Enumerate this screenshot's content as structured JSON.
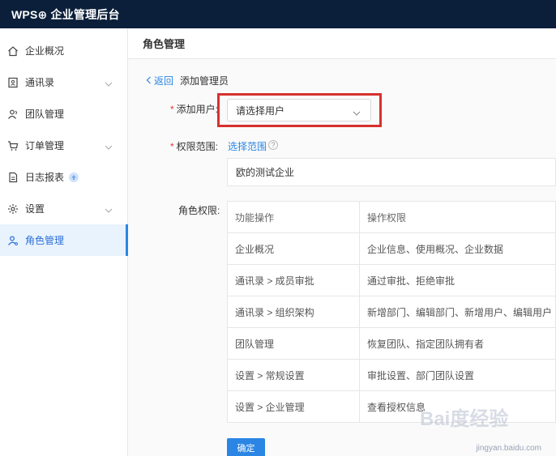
{
  "app": {
    "title": "WPS⊕ 企业管理后台"
  },
  "sidebar": {
    "items": [
      {
        "label": "企业概况"
      },
      {
        "label": "通讯录"
      },
      {
        "label": "团队管理"
      },
      {
        "label": "订单管理"
      },
      {
        "label": "日志报表"
      },
      {
        "label": "设置"
      },
      {
        "label": "角色管理"
      }
    ]
  },
  "page": {
    "title": "角色管理",
    "back_label": "返回",
    "crumb_current": "添加管理员"
  },
  "form": {
    "add_user_label": "添加用户:",
    "add_user_placeholder": "请选择用户",
    "scope_label": "权限范围:",
    "scope_link": "选择范围",
    "scope_value": "欧的测试企业",
    "perm_label": "角色权限:",
    "required_mark": "*",
    "help_mark": "?"
  },
  "table": {
    "headers": [
      "功能操作",
      "操作权限"
    ],
    "rows": [
      [
        "企业概况",
        "企业信息、使用概况、企业数据"
      ],
      [
        "通讯录 > 成员审批",
        "通过审批、拒绝审批"
      ],
      [
        "通讯录 > 组织架构",
        "新增部门、编辑部门、新增用户、编辑用户"
      ],
      [
        "团队管理",
        "恢复团队、指定团队拥有者"
      ],
      [
        "设置 > 常规设置",
        "审批设置、部门团队设置"
      ],
      [
        "设置 > 企业管理",
        "查看授权信息"
      ]
    ]
  },
  "actions": {
    "confirm_label": "确定"
  },
  "watermark": {
    "brand": "Bai度经验",
    "url": "jingyan.baidu.com"
  },
  "colors": {
    "topbar": "#0b1f3a",
    "accent": "#2b85e4",
    "highlight": "#d6322e",
    "required": "#e53935"
  }
}
